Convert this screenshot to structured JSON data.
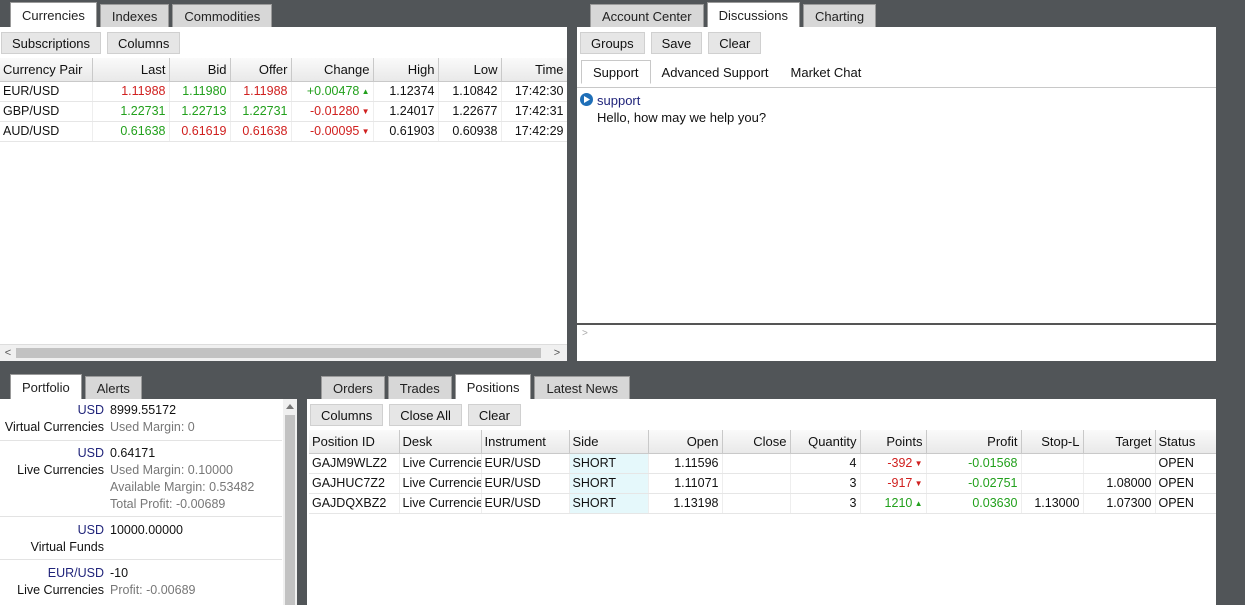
{
  "top_left": {
    "tabs": [
      "Currencies",
      "Indexes",
      "Commodities"
    ],
    "toolbar": {
      "subscriptions": "Subscriptions",
      "columns": "Columns"
    },
    "columns": [
      "Currency Pair",
      "Last",
      "Bid",
      "Offer",
      "Change",
      "High",
      "Low",
      "Time"
    ],
    "rows": [
      {
        "pair": "EUR/USD",
        "last": "1.11988",
        "bid": "1.11980",
        "offer": "1.11988",
        "change": "+0.00478",
        "high": "1.12374",
        "low": "1.10842",
        "time": "17:42:30"
      },
      {
        "pair": "GBP/USD",
        "last": "1.22731",
        "bid": "1.22713",
        "offer": "1.22731",
        "change": "-0.01280",
        "high": "1.24017",
        "low": "1.22677",
        "time": "17:42:31"
      },
      {
        "pair": "AUD/USD",
        "last": "0.61638",
        "bid": "0.61619",
        "offer": "0.61638",
        "change": "-0.00095",
        "high": "0.61903",
        "low": "0.60938",
        "time": "17:42:29"
      }
    ],
    "scroll_left": "<",
    "scroll_right": ">"
  },
  "top_right": {
    "tabs": [
      "Account Center",
      "Discussions",
      "Charting"
    ],
    "toolbar": {
      "groups": "Groups",
      "save": "Save",
      "clear": "Clear"
    },
    "subtabs": [
      "Support",
      "Advanced Support",
      "Market Chat"
    ],
    "message": {
      "sender": "support",
      "text": "Hello, how may we help you?"
    },
    "prompt": ">"
  },
  "bottom_left": {
    "tabs": [
      "Portfolio",
      "Alerts"
    ],
    "entries": [
      {
        "currency": "USD",
        "label": "Virtual Currencies",
        "value": "8999.55172",
        "lines": [
          "Used Margin:  0"
        ]
      },
      {
        "currency": "USD",
        "label": "Live Currencies",
        "value": "0.64171",
        "lines": [
          "Used Margin:  0.10000",
          "Available Margin:  0.53482",
          "Total Profit:  -0.00689"
        ]
      },
      {
        "currency": "USD",
        "label": "Virtual Funds",
        "value": "10000.00000",
        "lines": []
      },
      {
        "currency": "EUR/USD",
        "label": "Live Currencies",
        "value": "-10",
        "lines": [
          "Profit:  -0.00689"
        ]
      }
    ]
  },
  "bottom_right": {
    "tabs": [
      "Orders",
      "Trades",
      "Positions",
      "Latest News"
    ],
    "toolbar": {
      "columns": "Columns",
      "close_all": "Close All",
      "clear": "Clear"
    },
    "columns": [
      "Position ID",
      "Desk",
      "Instrument",
      "Side",
      "Open",
      "Close",
      "Quantity",
      "Points",
      "Profit",
      "Stop-L",
      "Target",
      "Status"
    ],
    "rows": [
      {
        "id": "GAJM9WLZ2",
        "desk": "Live Currencies",
        "instrument": "EUR/USD",
        "side": "SHORT",
        "open": "1.11596",
        "close": "",
        "quantity": "4",
        "points": "-392",
        "profit": "-0.01568",
        "stop": "",
        "target": "",
        "status": "OPEN"
      },
      {
        "id": "GAJHUC7Z2",
        "desk": "Live Currencies",
        "instrument": "EUR/USD",
        "side": "SHORT",
        "open": "1.11071",
        "close": "",
        "quantity": "3",
        "points": "-917",
        "profit": "-0.02751",
        "stop": "",
        "target": "1.08000",
        "status": "OPEN"
      },
      {
        "id": "GAJDQXBZ2",
        "desk": "Live Currencies",
        "instrument": "EUR/USD",
        "side": "SHORT",
        "open": "1.13198",
        "close": "",
        "quantity": "3",
        "points": "1210",
        "profit": "0.03630",
        "stop": "1.13000",
        "target": "1.07300",
        "status": "OPEN"
      }
    ]
  }
}
